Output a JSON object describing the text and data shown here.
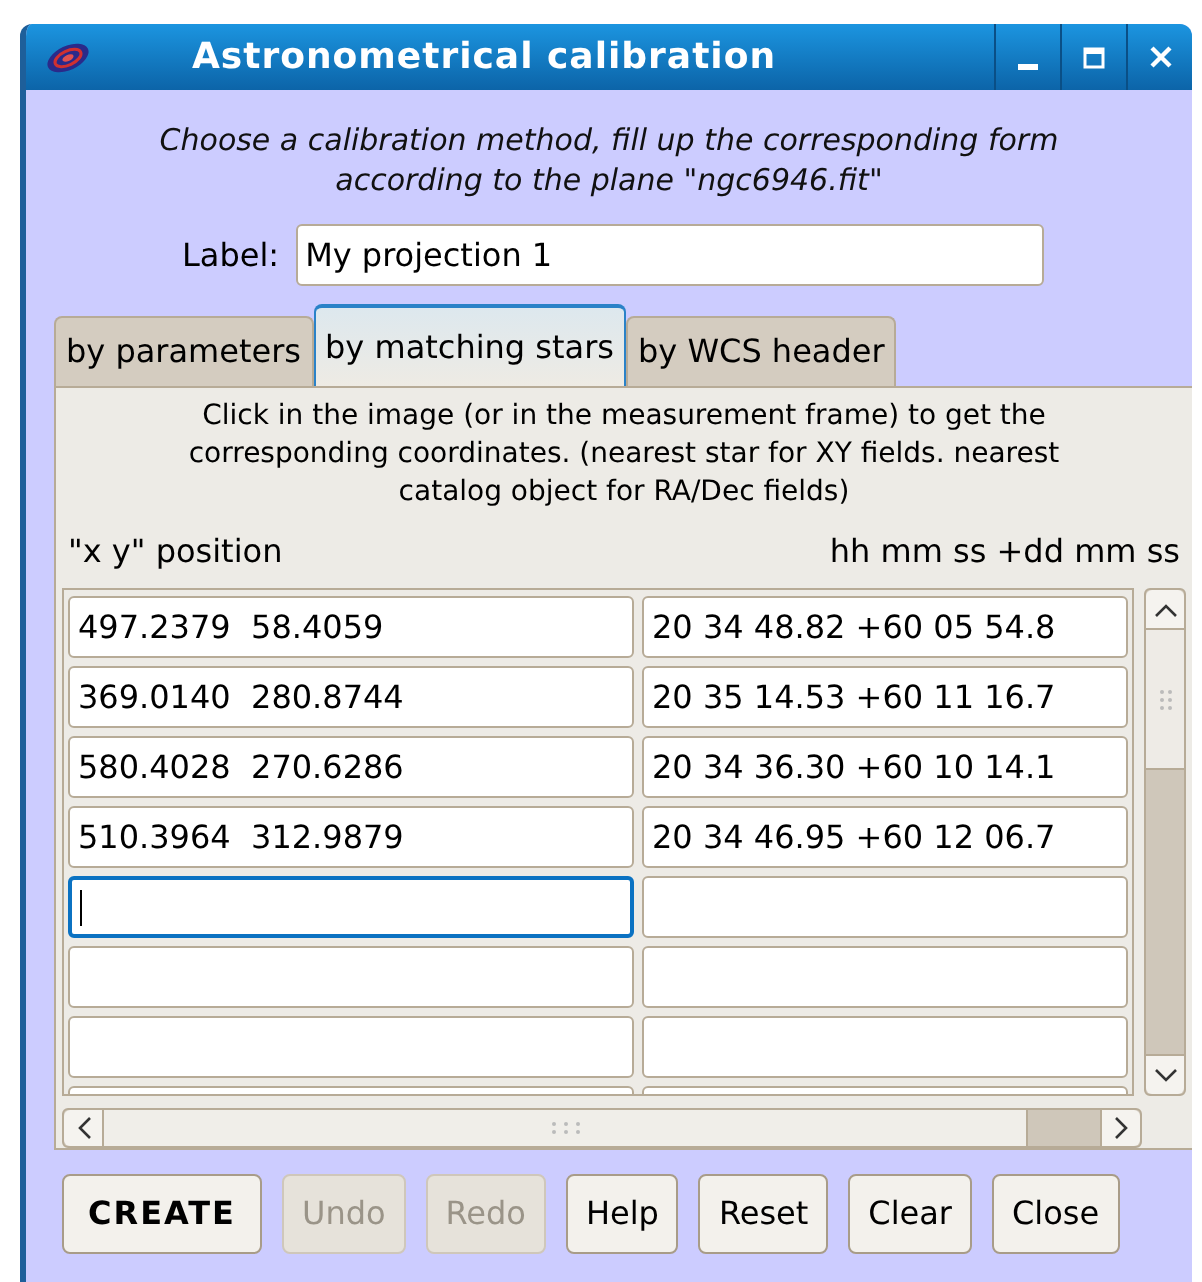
{
  "window": {
    "title": "Astronometrical calibration"
  },
  "intro": "Choose a calibration method, fill up the corresponding form according to the plane \"ngc6946.fit\"",
  "label_field": {
    "label": "Label:",
    "value": "My projection 1"
  },
  "tabs": [
    {
      "label": "by parameters",
      "selected": false
    },
    {
      "label": "by matching stars",
      "selected": true
    },
    {
      "label": "by WCS header",
      "selected": false
    }
  ],
  "instructions": "Click in the image (or in the measurement frame) to get the corresponding coordinates. (nearest star for XY fields. nearest catalog object for RA/Dec fields)",
  "columns": [
    "\"x y\" position",
    "hh mm ss +dd mm ss"
  ],
  "rows": [
    {
      "xy": "497.2379  58.4059",
      "radec": "20 34 48.82 +60 05 54.8",
      "focused": false
    },
    {
      "xy": "369.0140  280.8744",
      "radec": "20 35 14.53 +60 11 16.7",
      "focused": false
    },
    {
      "xy": "580.4028  270.6286",
      "radec": "20 34 36.30 +60 10 14.1",
      "focused": false
    },
    {
      "xy": "510.3964  312.9879",
      "radec": "20 34 46.95 +60 12 06.7",
      "focused": false
    },
    {
      "focused": true
    },
    {
      "focused": false
    },
    {
      "focused": false
    },
    {
      "focused": false
    }
  ],
  "buttons": [
    {
      "label": "CREATE",
      "kind": "bold",
      "disabled": false
    },
    {
      "label": "Undo",
      "kind": "normal",
      "disabled": true
    },
    {
      "label": "Redo",
      "kind": "normal",
      "disabled": true
    },
    {
      "label": "Help",
      "kind": "normal",
      "disabled": false
    },
    {
      "label": "Reset",
      "kind": "normal",
      "disabled": false
    },
    {
      "label": "Clear",
      "kind": "normal",
      "disabled": false
    },
    {
      "label": "Close",
      "kind": "normal",
      "disabled": false
    }
  ]
}
